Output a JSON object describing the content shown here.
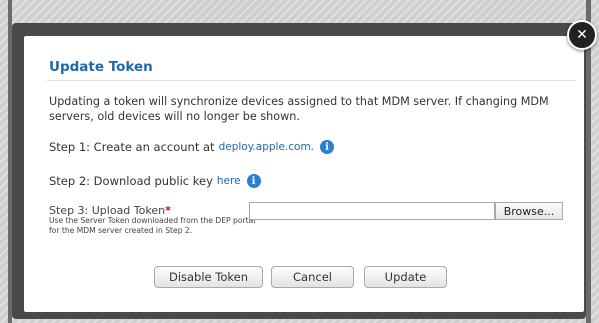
{
  "dialog": {
    "title": "Update Token",
    "description": "Updating a token will synchronize devices assigned to that MDM server. If changing MDM servers, old devices will no longer be shown.",
    "close_icon": "close-icon",
    "step1": {
      "text": "Step 1: Create an account at",
      "link": "deploy.apple.com.",
      "info_icon": "info-icon"
    },
    "step2": {
      "text": "Step 2: Download public key",
      "link": "here",
      "info_icon": "info-icon"
    },
    "step3": {
      "label": "Step 3: Upload Token",
      "required_marker": "*",
      "help": "Use the Server Token downloaded from the DEP portal for the MDM server created in Step 2.",
      "file_value": "",
      "browse_label": "Browse..."
    },
    "buttons": {
      "disable": "Disable Token",
      "cancel": "Cancel",
      "update": "Update"
    },
    "colors": {
      "title": "#1d6aa6",
      "link": "#1d6aa6",
      "info_icon": "#2a7fd0",
      "required": "#d0021b"
    }
  }
}
